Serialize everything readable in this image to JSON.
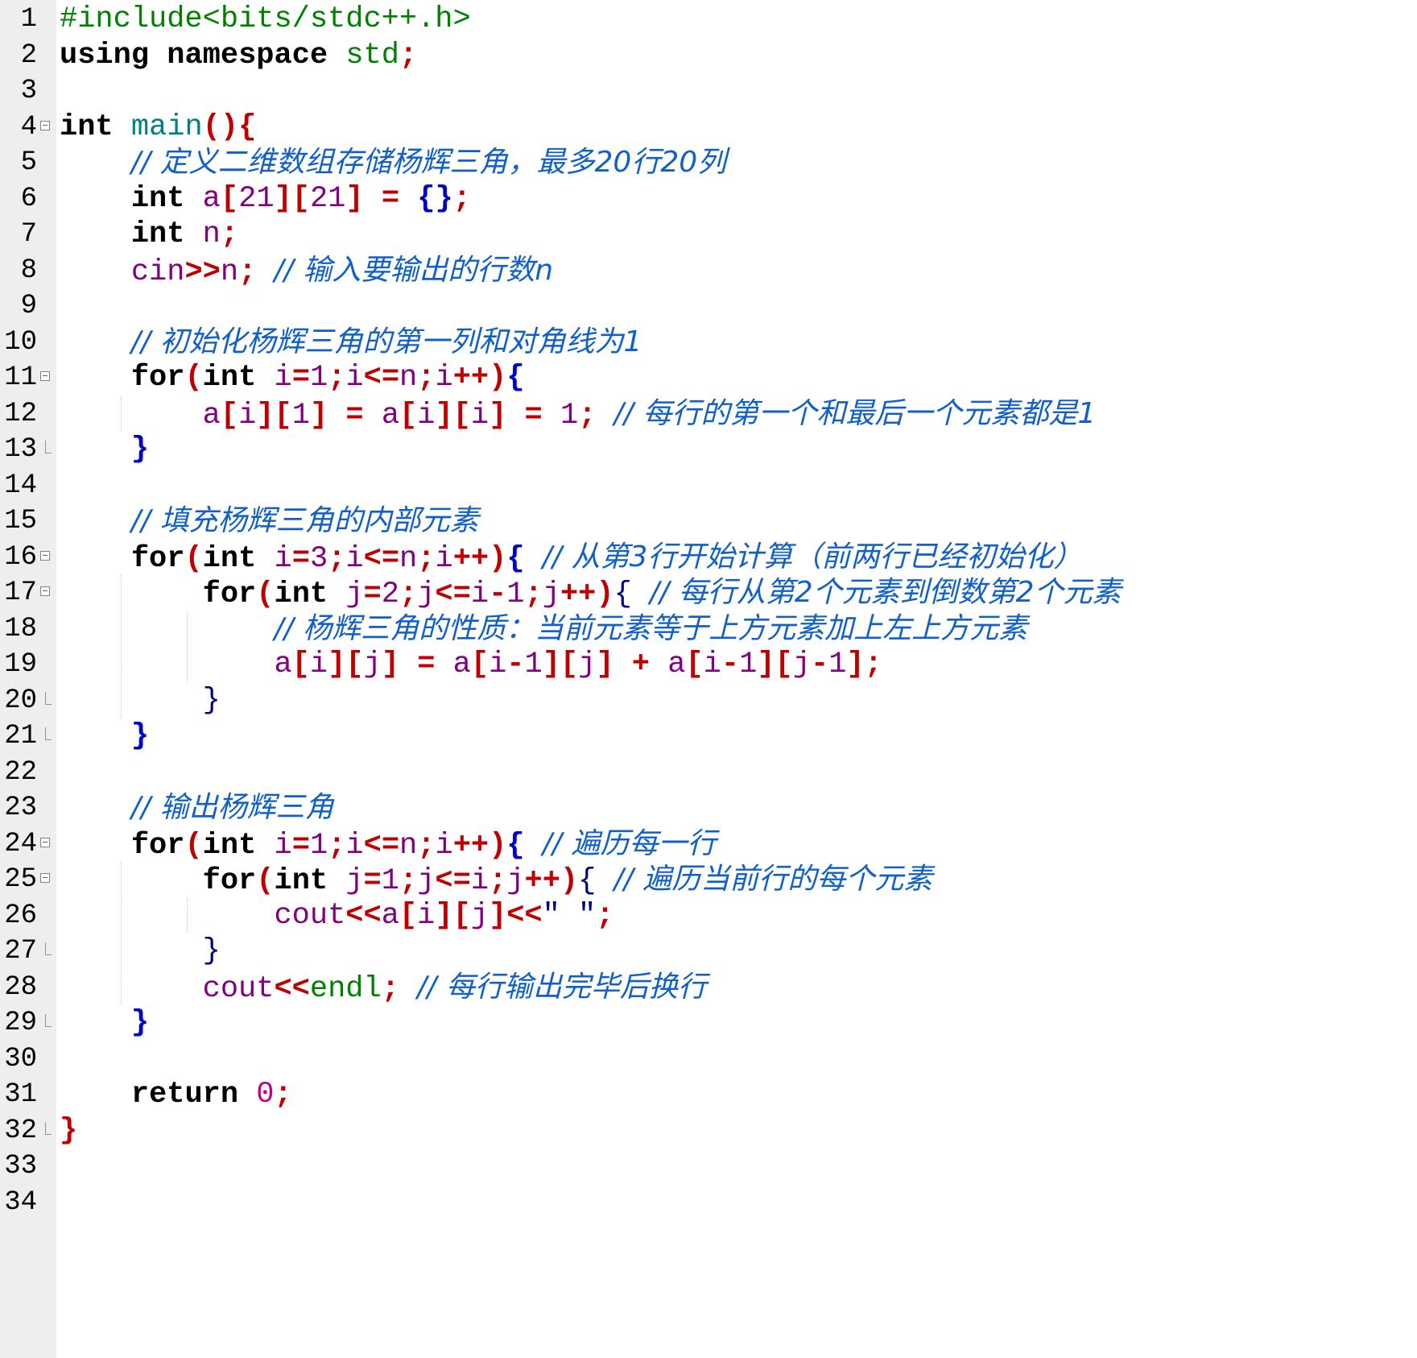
{
  "editor": {
    "gutter": {
      "line_numbers": [
        "1",
        "2",
        "3",
        "4",
        "5",
        "6",
        "7",
        "8",
        "9",
        "10",
        "11",
        "12",
        "13",
        "14",
        "15",
        "16",
        "17",
        "18",
        "19",
        "20",
        "21",
        "22",
        "23",
        "24",
        "25",
        "26",
        "27",
        "28",
        "29",
        "30",
        "31",
        "32",
        "33",
        "34"
      ]
    },
    "colors": {
      "background": "#ffffff",
      "gutter": "#eeeeee",
      "keyword": "#000000",
      "comment": "#1060c8",
      "operator": "#c00000",
      "preprocessor": "#008000",
      "identifier": "#800080"
    },
    "lines": [
      {
        "tokens": [
          {
            "t": "pre",
            "v": "#include<bits/stdc++.h>"
          }
        ]
      },
      {
        "tokens": [
          {
            "t": "kw",
            "v": "using"
          },
          {
            "t": "plain",
            "v": " "
          },
          {
            "t": "kw",
            "v": "namespace"
          },
          {
            "t": "plain",
            "v": " "
          },
          {
            "t": "pre",
            "v": "std"
          },
          {
            "t": "op",
            "v": ";"
          }
        ]
      },
      {
        "tokens": []
      },
      {
        "tokens": [
          {
            "t": "kw",
            "v": "int"
          },
          {
            "t": "plain",
            "v": " "
          },
          {
            "t": "typ",
            "v": "main"
          },
          {
            "t": "op",
            "v": "(){"
          }
        ]
      },
      {
        "tokens": [
          {
            "t": "plain",
            "v": "    "
          },
          {
            "t": "com",
            "v": "// 定义二维数组存储杨辉三角，最多20行20列"
          }
        ]
      },
      {
        "tokens": [
          {
            "t": "plain",
            "v": "    "
          },
          {
            "t": "kw",
            "v": "int"
          },
          {
            "t": "plain",
            "v": " "
          },
          {
            "t": "id",
            "v": "a"
          },
          {
            "t": "op",
            "v": "["
          },
          {
            "t": "num",
            "v": "21"
          },
          {
            "t": "op",
            "v": "]["
          },
          {
            "t": "num",
            "v": "21"
          },
          {
            "t": "op",
            "v": "]"
          },
          {
            "t": "plain",
            "v": " "
          },
          {
            "t": "op",
            "v": "="
          },
          {
            "t": "plain",
            "v": " "
          },
          {
            "t": "brace",
            "v": "{}"
          },
          {
            "t": "op",
            "v": ";"
          }
        ]
      },
      {
        "tokens": [
          {
            "t": "plain",
            "v": "    "
          },
          {
            "t": "kw",
            "v": "int"
          },
          {
            "t": "plain",
            "v": " "
          },
          {
            "t": "id",
            "v": "n"
          },
          {
            "t": "op",
            "v": ";"
          }
        ]
      },
      {
        "tokens": [
          {
            "t": "plain",
            "v": "    "
          },
          {
            "t": "id",
            "v": "cin"
          },
          {
            "t": "op",
            "v": ">>"
          },
          {
            "t": "id",
            "v": "n"
          },
          {
            "t": "op",
            "v": ";"
          },
          {
            "t": "plain",
            "v": " "
          },
          {
            "t": "com",
            "v": "// 输入要输出的行数n"
          }
        ]
      },
      {
        "tokens": []
      },
      {
        "tokens": [
          {
            "t": "plain",
            "v": "    "
          },
          {
            "t": "com",
            "v": "// 初始化杨辉三角的第一列和对角线为1"
          }
        ]
      },
      {
        "tokens": [
          {
            "t": "plain",
            "v": "    "
          },
          {
            "t": "kw",
            "v": "for"
          },
          {
            "t": "op",
            "v": "("
          },
          {
            "t": "kw",
            "v": "int"
          },
          {
            "t": "plain",
            "v": " "
          },
          {
            "t": "id",
            "v": "i"
          },
          {
            "t": "op",
            "v": "="
          },
          {
            "t": "num",
            "v": "1"
          },
          {
            "t": "op",
            "v": ";"
          },
          {
            "t": "id",
            "v": "i"
          },
          {
            "t": "op",
            "v": "<="
          },
          {
            "t": "id",
            "v": "n"
          },
          {
            "t": "op",
            "v": ";"
          },
          {
            "t": "id",
            "v": "i"
          },
          {
            "t": "op",
            "v": "++)"
          },
          {
            "t": "brace",
            "v": "{"
          }
        ]
      },
      {
        "tokens": [
          {
            "t": "plain",
            "v": "        "
          },
          {
            "t": "id",
            "v": "a"
          },
          {
            "t": "op",
            "v": "["
          },
          {
            "t": "id",
            "v": "i"
          },
          {
            "t": "op",
            "v": "]["
          },
          {
            "t": "num",
            "v": "1"
          },
          {
            "t": "op",
            "v": "]"
          },
          {
            "t": "plain",
            "v": " "
          },
          {
            "t": "op",
            "v": "="
          },
          {
            "t": "plain",
            "v": " "
          },
          {
            "t": "id",
            "v": "a"
          },
          {
            "t": "op",
            "v": "["
          },
          {
            "t": "id",
            "v": "i"
          },
          {
            "t": "op",
            "v": "]["
          },
          {
            "t": "id",
            "v": "i"
          },
          {
            "t": "op",
            "v": "]"
          },
          {
            "t": "plain",
            "v": " "
          },
          {
            "t": "op",
            "v": "="
          },
          {
            "t": "plain",
            "v": " "
          },
          {
            "t": "num",
            "v": "1"
          },
          {
            "t": "op",
            "v": ";"
          },
          {
            "t": "plain",
            "v": " "
          },
          {
            "t": "com",
            "v": "// 每行的第一个和最后一个元素都是1"
          }
        ]
      },
      {
        "tokens": [
          {
            "t": "plain",
            "v": "    "
          },
          {
            "t": "brace",
            "v": "}"
          }
        ]
      },
      {
        "tokens": []
      },
      {
        "tokens": [
          {
            "t": "plain",
            "v": "    "
          },
          {
            "t": "com",
            "v": "// 填充杨辉三角的内部元素"
          }
        ]
      },
      {
        "tokens": [
          {
            "t": "plain",
            "v": "    "
          },
          {
            "t": "kw",
            "v": "for"
          },
          {
            "t": "op",
            "v": "("
          },
          {
            "t": "kw",
            "v": "int"
          },
          {
            "t": "plain",
            "v": " "
          },
          {
            "t": "id",
            "v": "i"
          },
          {
            "t": "op",
            "v": "="
          },
          {
            "t": "num",
            "v": "3"
          },
          {
            "t": "op",
            "v": ";"
          },
          {
            "t": "id",
            "v": "i"
          },
          {
            "t": "op",
            "v": "<="
          },
          {
            "t": "id",
            "v": "n"
          },
          {
            "t": "op",
            "v": ";"
          },
          {
            "t": "id",
            "v": "i"
          },
          {
            "t": "op",
            "v": "++)"
          },
          {
            "t": "brace",
            "v": "{"
          },
          {
            "t": "plain",
            "v": " "
          },
          {
            "t": "com",
            "v": "// 从第3行开始计算（前两行已经初始化）"
          }
        ]
      },
      {
        "tokens": [
          {
            "t": "plain",
            "v": "        "
          },
          {
            "t": "kw",
            "v": "for"
          },
          {
            "t": "op",
            "v": "("
          },
          {
            "t": "kw",
            "v": "int"
          },
          {
            "t": "plain",
            "v": " "
          },
          {
            "t": "id",
            "v": "j"
          },
          {
            "t": "op",
            "v": "="
          },
          {
            "t": "num",
            "v": "2"
          },
          {
            "t": "op",
            "v": ";"
          },
          {
            "t": "id",
            "v": "j"
          },
          {
            "t": "op",
            "v": "<="
          },
          {
            "t": "id",
            "v": "i"
          },
          {
            "t": "op",
            "v": "-"
          },
          {
            "t": "num",
            "v": "1"
          },
          {
            "t": "op",
            "v": ";"
          },
          {
            "t": "id",
            "v": "j"
          },
          {
            "t": "op",
            "v": "++)"
          },
          {
            "t": "plain",
            "v": "{"
          },
          {
            "t": "plain",
            "v": " "
          },
          {
            "t": "com",
            "v": "// 每行从第2个元素到倒数第2个元素"
          }
        ]
      },
      {
        "tokens": [
          {
            "t": "plain",
            "v": "            "
          },
          {
            "t": "com",
            "v": "// 杨辉三角的性质：当前元素等于上方元素加上左上方元素"
          }
        ]
      },
      {
        "tokens": [
          {
            "t": "plain",
            "v": "            "
          },
          {
            "t": "id",
            "v": "a"
          },
          {
            "t": "op",
            "v": "["
          },
          {
            "t": "id",
            "v": "i"
          },
          {
            "t": "op",
            "v": "]["
          },
          {
            "t": "id",
            "v": "j"
          },
          {
            "t": "op",
            "v": "]"
          },
          {
            "t": "plain",
            "v": " "
          },
          {
            "t": "op",
            "v": "="
          },
          {
            "t": "plain",
            "v": " "
          },
          {
            "t": "id",
            "v": "a"
          },
          {
            "t": "op",
            "v": "["
          },
          {
            "t": "id",
            "v": "i"
          },
          {
            "t": "op",
            "v": "-"
          },
          {
            "t": "num",
            "v": "1"
          },
          {
            "t": "op",
            "v": "]["
          },
          {
            "t": "id",
            "v": "j"
          },
          {
            "t": "op",
            "v": "]"
          },
          {
            "t": "plain",
            "v": " "
          },
          {
            "t": "op",
            "v": "+"
          },
          {
            "t": "plain",
            "v": " "
          },
          {
            "t": "id",
            "v": "a"
          },
          {
            "t": "op",
            "v": "["
          },
          {
            "t": "id",
            "v": "i"
          },
          {
            "t": "op",
            "v": "-"
          },
          {
            "t": "num",
            "v": "1"
          },
          {
            "t": "op",
            "v": "]["
          },
          {
            "t": "id",
            "v": "j"
          },
          {
            "t": "op",
            "v": "-"
          },
          {
            "t": "num",
            "v": "1"
          },
          {
            "t": "op",
            "v": "];"
          }
        ]
      },
      {
        "tokens": [
          {
            "t": "plain",
            "v": "        "
          },
          {
            "t": "plain",
            "v": "}"
          }
        ]
      },
      {
        "tokens": [
          {
            "t": "plain",
            "v": "    "
          },
          {
            "t": "brace",
            "v": "}"
          }
        ]
      },
      {
        "tokens": []
      },
      {
        "tokens": [
          {
            "t": "plain",
            "v": "    "
          },
          {
            "t": "com",
            "v": "// 输出杨辉三角"
          }
        ]
      },
      {
        "tokens": [
          {
            "t": "plain",
            "v": "    "
          },
          {
            "t": "kw",
            "v": "for"
          },
          {
            "t": "op",
            "v": "("
          },
          {
            "t": "kw",
            "v": "int"
          },
          {
            "t": "plain",
            "v": " "
          },
          {
            "t": "id",
            "v": "i"
          },
          {
            "t": "op",
            "v": "="
          },
          {
            "t": "num",
            "v": "1"
          },
          {
            "t": "op",
            "v": ";"
          },
          {
            "t": "id",
            "v": "i"
          },
          {
            "t": "op",
            "v": "<="
          },
          {
            "t": "id",
            "v": "n"
          },
          {
            "t": "op",
            "v": ";"
          },
          {
            "t": "id",
            "v": "i"
          },
          {
            "t": "op",
            "v": "++)"
          },
          {
            "t": "brace",
            "v": "{"
          },
          {
            "t": "plain",
            "v": " "
          },
          {
            "t": "com",
            "v": "// 遍历每一行"
          }
        ]
      },
      {
        "tokens": [
          {
            "t": "plain",
            "v": "        "
          },
          {
            "t": "kw",
            "v": "for"
          },
          {
            "t": "op",
            "v": "("
          },
          {
            "t": "kw",
            "v": "int"
          },
          {
            "t": "plain",
            "v": " "
          },
          {
            "t": "id",
            "v": "j"
          },
          {
            "t": "op",
            "v": "="
          },
          {
            "t": "num",
            "v": "1"
          },
          {
            "t": "op",
            "v": ";"
          },
          {
            "t": "id",
            "v": "j"
          },
          {
            "t": "op",
            "v": "<="
          },
          {
            "t": "id",
            "v": "i"
          },
          {
            "t": "op",
            "v": ";"
          },
          {
            "t": "id",
            "v": "j"
          },
          {
            "t": "op",
            "v": "++)"
          },
          {
            "t": "plain",
            "v": "{"
          },
          {
            "t": "plain",
            "v": " "
          },
          {
            "t": "com",
            "v": "// 遍历当前行的每个元素"
          }
        ]
      },
      {
        "tokens": [
          {
            "t": "plain",
            "v": "            "
          },
          {
            "t": "id",
            "v": "cout"
          },
          {
            "t": "op",
            "v": "<<"
          },
          {
            "t": "id",
            "v": "a"
          },
          {
            "t": "op",
            "v": "["
          },
          {
            "t": "id",
            "v": "i"
          },
          {
            "t": "op",
            "v": "]["
          },
          {
            "t": "id",
            "v": "j"
          },
          {
            "t": "op",
            "v": "]<<"
          },
          {
            "t": "str",
            "v": "\" \""
          },
          {
            "t": "op",
            "v": ";"
          }
        ]
      },
      {
        "tokens": [
          {
            "t": "plain",
            "v": "        "
          },
          {
            "t": "plain",
            "v": "}"
          }
        ]
      },
      {
        "tokens": [
          {
            "t": "plain",
            "v": "        "
          },
          {
            "t": "id",
            "v": "cout"
          },
          {
            "t": "op",
            "v": "<<"
          },
          {
            "t": "pre",
            "v": "endl"
          },
          {
            "t": "op",
            "v": ";"
          },
          {
            "t": "plain",
            "v": " "
          },
          {
            "t": "com",
            "v": "// 每行输出完毕后换行"
          }
        ]
      },
      {
        "tokens": [
          {
            "t": "plain",
            "v": "    "
          },
          {
            "t": "brace",
            "v": "}"
          }
        ]
      },
      {
        "tokens": []
      },
      {
        "tokens": [
          {
            "t": "plain",
            "v": "    "
          },
          {
            "t": "kw",
            "v": "return"
          },
          {
            "t": "plain",
            "v": " "
          },
          {
            "t": "num0",
            "v": "0"
          },
          {
            "t": "op",
            "v": ";"
          }
        ]
      },
      {
        "tokens": [
          {
            "t": "op",
            "v": "}"
          }
        ]
      },
      {
        "tokens": []
      },
      {
        "tokens": []
      }
    ]
  }
}
